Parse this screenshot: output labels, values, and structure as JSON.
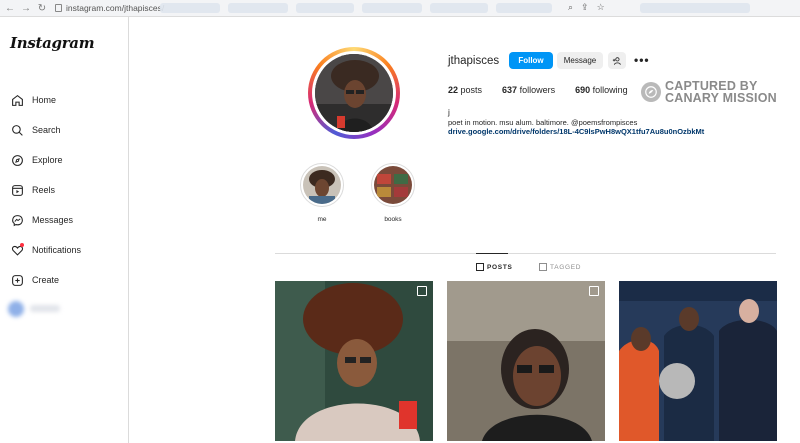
{
  "browser": {
    "url": "instagram.com/jthapisces/"
  },
  "sidebar": {
    "logo": "Instagram",
    "items": [
      {
        "label": "Home",
        "icon": "home-icon"
      },
      {
        "label": "Search",
        "icon": "search-icon"
      },
      {
        "label": "Explore",
        "icon": "compass-icon"
      },
      {
        "label": "Reels",
        "icon": "reels-icon"
      },
      {
        "label": "Messages",
        "icon": "messenger-icon"
      },
      {
        "label": "Notifications",
        "icon": "heart-icon"
      },
      {
        "label": "Create",
        "icon": "plus-square-icon"
      }
    ]
  },
  "profile": {
    "username": "jthapisces",
    "follow_label": "Follow",
    "message_label": "Message",
    "posts_count": "22",
    "posts_label": "posts",
    "followers_count": "637",
    "followers_label": "followers",
    "following_count": "690",
    "following_label": "following",
    "display_name": "j",
    "bio": "poet in motion. msu alum. baltimore. @poemsfrompisces",
    "link": "drive.google.com/drive/folders/18L-4C9lsPwH8wQX1tfu7Au8u0nOzbkMt"
  },
  "watermark": {
    "line1": "CAPTURED BY",
    "line2": "CANARY MISSION"
  },
  "highlights": [
    {
      "label": "me"
    },
    {
      "label": "books"
    }
  ],
  "tabs": {
    "posts": "POSTS",
    "tagged": "TAGGED"
  },
  "colors": {
    "accent": "#0095f6",
    "link": "#00376b",
    "border": "#dbdbdb"
  }
}
